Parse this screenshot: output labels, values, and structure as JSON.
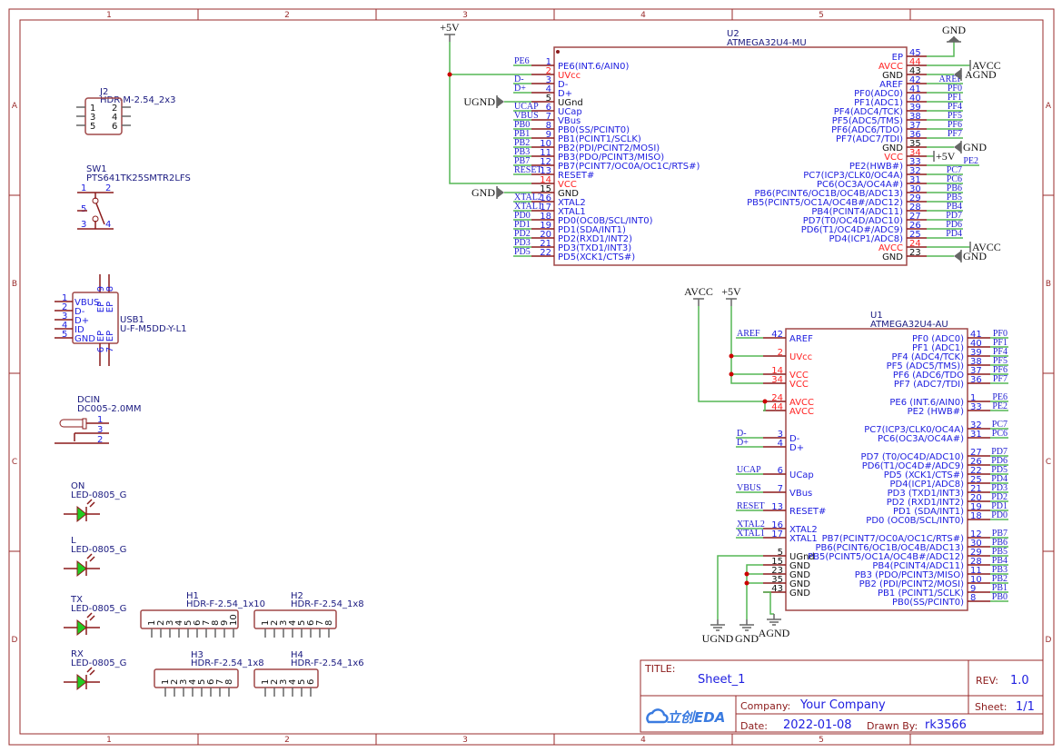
{
  "frame": {
    "columns": [
      "1",
      "2",
      "3",
      "4",
      "5"
    ],
    "rows": [
      "A",
      "B",
      "C",
      "D"
    ]
  },
  "u2": {
    "ref": "U2",
    "value": "ATMEGA32U4-MU",
    "left": [
      [
        "1",
        "PE6(INT.6/AIN0)",
        "PE6",
        "io"
      ],
      [
        "2",
        "UVcc",
        "",
        "pwr"
      ],
      [
        "3",
        "D-",
        "D-",
        "io"
      ],
      [
        "4",
        "D+",
        "D+",
        "io"
      ],
      [
        "5",
        "UGnd",
        "",
        "gnd"
      ],
      [
        "6",
        "UCap",
        "UCAP",
        "io"
      ],
      [
        "7",
        "VBus",
        "VBUS",
        "io"
      ],
      [
        "8",
        "PB0(SS/PCINT0)",
        "PB0",
        "io"
      ],
      [
        "9",
        "PB1(PCINT1/SCLK)",
        "PB1",
        "io"
      ],
      [
        "10",
        "PB2(PDI/PCINT2/MOSI)",
        "PB2",
        "io"
      ],
      [
        "11",
        "PB3(PDO/PCINT3/MISO)",
        "PB3",
        "io"
      ],
      [
        "12",
        "PB7(PCINT7/OC0A/OC1C/RTS#)",
        "PB7",
        "io"
      ],
      [
        "13",
        "RESET#",
        "RESET",
        "io"
      ],
      [
        "14",
        "VCC",
        "",
        "pwr"
      ],
      [
        "15",
        "GND",
        "",
        "gnd"
      ],
      [
        "16",
        "XTAL2",
        "XTAL2",
        "io"
      ],
      [
        "17",
        "XTAL1",
        "XTAL1",
        "io"
      ],
      [
        "18",
        "PD0(OC0B/SCL/INT0)",
        "PD0",
        "io"
      ],
      [
        "19",
        "PD1(SDA/INT1)",
        "PD1",
        "io"
      ],
      [
        "20",
        "PD2(RXD1/INT2)",
        "PD2",
        "io"
      ],
      [
        "21",
        "PD3(TXD1/INT3)",
        "PD3",
        "io"
      ],
      [
        "22",
        "PD5(XCK1/CTS#)",
        "PD5",
        "io"
      ]
    ],
    "right": [
      [
        "45",
        "EP",
        "",
        "io"
      ],
      [
        "44",
        "AVCC",
        "",
        "pwr"
      ],
      [
        "43",
        "GND",
        "",
        "gnd"
      ],
      [
        "42",
        "AREF",
        "AREF",
        "io"
      ],
      [
        "41",
        "PF0(ADC0)",
        "PF0",
        "io"
      ],
      [
        "40",
        "PF1(ADC1)",
        "PF1",
        "io"
      ],
      [
        "39",
        "PF4(ADC4/TCK)",
        "PF4",
        "io"
      ],
      [
        "38",
        "PF5(ADC5/TMS)",
        "PF5",
        "io"
      ],
      [
        "37",
        "PF6(ADC6/TDO)",
        "PF6",
        "io"
      ],
      [
        "36",
        "PF7(ADC7/TDI)",
        "PF7",
        "io"
      ],
      [
        "35",
        "GND",
        "",
        "gnd"
      ],
      [
        "34",
        "VCC",
        "",
        "pwr"
      ],
      [
        "33",
        "PE2(HWB#)",
        "PE2",
        "io"
      ],
      [
        "32",
        "PC7(ICP3/CLK0/OC4A)",
        "PC7",
        "io"
      ],
      [
        "31",
        "PC6(OC3A/OC4A#)",
        "PC6",
        "io"
      ],
      [
        "30",
        "PB6(PCINT6/OC1B/OC4B/ADC13)",
        "PB6",
        "io"
      ],
      [
        "29",
        "PB5(PCINT5/OC1A/OC4B#/ADC12)",
        "PB5",
        "io"
      ],
      [
        "28",
        "PB4(PCINT4/ADC11)",
        "PB4",
        "io"
      ],
      [
        "27",
        "PD7(T0/OC4D/ADC10)",
        "PD7",
        "io"
      ],
      [
        "26",
        "PD6(T1/OC4D#/ADC9)",
        "PD6",
        "io"
      ],
      [
        "25",
        "PD4(ICP1/ADC8)",
        "PD4",
        "io"
      ],
      [
        "24",
        "AVCC",
        "",
        "pwr"
      ],
      [
        "23",
        "GND",
        "",
        "gnd"
      ]
    ]
  },
  "u1": {
    "ref": "U1",
    "value": "ATMEGA32U4-AU",
    "left": [
      [
        "42",
        "AREF",
        "AREF",
        "io"
      ],
      [
        "2",
        "UVcc",
        "",
        "pwr"
      ],
      [
        "14",
        "VCC",
        "",
        "pwr"
      ],
      [
        "34",
        "VCC",
        "",
        "pwr"
      ],
      [
        "24",
        "AVCC",
        "",
        "pwr"
      ],
      [
        "44",
        "AVCC",
        "",
        "pwr"
      ],
      [
        "3",
        "D-",
        "D-",
        "io"
      ],
      [
        "4",
        "D+",
        "D+",
        "io"
      ],
      [
        "6",
        "UCap",
        "UCAP",
        "io"
      ],
      [
        "7",
        "VBus",
        "VBUS",
        "io"
      ],
      [
        "13",
        "RESET#",
        "RESET",
        "io"
      ],
      [
        "16",
        "XTAL2",
        "XTAL2",
        "io"
      ],
      [
        "17",
        "XTAL1",
        "XTAL1",
        "io"
      ],
      [
        "5",
        "UGnd",
        "",
        "gnd"
      ],
      [
        "15",
        "GND",
        "",
        "gnd"
      ],
      [
        "23",
        "GND",
        "",
        "gnd"
      ],
      [
        "35",
        "GND",
        "",
        "gnd"
      ],
      [
        "43",
        "GND",
        "",
        "gnd"
      ]
    ],
    "right": [
      [
        "41",
        "PF0 (ADC0)",
        "PF0",
        "io"
      ],
      [
        "40",
        "PF1 (ADC1)",
        "PF1",
        "io"
      ],
      [
        "39",
        "PF4 (ADC4/TCK)",
        "PF4",
        "io"
      ],
      [
        "38",
        "PF5 (ADC5/TMS))",
        "PF5",
        "io"
      ],
      [
        "37",
        "PF6 (ADC6/TDO",
        "PF6",
        "io"
      ],
      [
        "36",
        "PF7 (ADC7/TDI)",
        "PF7",
        "io"
      ],
      [
        "1",
        "PE6 (INT.6/AIN0)",
        "PE6",
        "io"
      ],
      [
        "33",
        "PE2 (HWB#)",
        "PE2",
        "io"
      ],
      [
        "32",
        "PC7(ICP3/CLK0/OC4A)",
        "PC7",
        "io"
      ],
      [
        "31",
        "PC6(OC3A/OC4A#)",
        "PC6",
        "io"
      ],
      [
        "27",
        "PD7 (T0/OC4D/ADC10)",
        "PD7",
        "io"
      ],
      [
        "26",
        "PD6(T1/OC4D#/ADC9)",
        "PD6",
        "io"
      ],
      [
        "22",
        "PD5 (XCK1/CTS#)",
        "PD5",
        "io"
      ],
      [
        "25",
        "PD4(ICP1/ADC8)",
        "PD4",
        "io"
      ],
      [
        "21",
        "PD3 (TXD1/INT3)",
        "PD3",
        "io"
      ],
      [
        "20",
        "PD2 (RXD1/INT2)",
        "PD2",
        "io"
      ],
      [
        "19",
        "PD1 (SDA/INT1)",
        "PD1",
        "io"
      ],
      [
        "18",
        "PD0 (OC0B/SCL/INT0)",
        "PD0",
        "io"
      ],
      [
        "12",
        "PB7(PCINT7/OC0A/OC1C/RTS#)",
        "PB7",
        "io"
      ],
      [
        "30",
        "PB6(PCINT6/OC1B/OC4B/ADC13)",
        "PB6",
        "io"
      ],
      [
        "29",
        "PB5(PCINT5/OC1A/OC4B#/ADC12)",
        "PB5",
        "io"
      ],
      [
        "28",
        "PB4(PCINT4/ADC11)",
        "PB4",
        "io"
      ],
      [
        "11",
        "PB3 (PDO/PCINT3/MISO)",
        "PB3",
        "io"
      ],
      [
        "10",
        "PB2 (PDI/PCINT2/MOSI)",
        "PB2",
        "io"
      ],
      [
        "9",
        "PB1 (PCINT1/SCLK)",
        "PB1",
        "io"
      ],
      [
        "8",
        "PB0(SS/PCINT0)",
        "PB0",
        "io"
      ]
    ]
  },
  "power": {
    "u2_5v": "+5V",
    "u2_ugnd": "UGND",
    "u2_gnd_left": "GND",
    "u2_gnd_ep": "GND",
    "u2_avcc_44": "AVCC",
    "u2_agnd": "AGND",
    "u2_gnd_35": "GND",
    "u2_5v_34": "+5V",
    "u2_avcc_24": "AVCC",
    "u2_gnd_23": "GND",
    "u1_avcc": "AVCC",
    "u1_5v": "+5V",
    "u1_ugnd": "UGND",
    "u1_gnd": "GND",
    "u1_agnd": "AGND"
  },
  "components": {
    "j2": {
      "ref": "J2",
      "value": "HDR-M-2.54_2x3",
      "pins": [
        "1",
        "2",
        "3",
        "4",
        "5",
        "6"
      ]
    },
    "sw1": {
      "ref": "SW1",
      "value": "PTS641TK25SMTR2LFS",
      "pins": [
        "1",
        "2",
        "3",
        "4",
        "5"
      ]
    },
    "usb1": {
      "ref": "USB1",
      "value": "U-F-M5DD-Y-L1",
      "pins": [
        "1",
        "2",
        "3",
        "4",
        "5"
      ],
      "names": [
        "VBUS",
        "D-",
        "D+",
        "ID",
        "GND"
      ],
      "ep": "EP",
      "ep_pins": [
        "9",
        "8",
        "6",
        "7"
      ]
    },
    "dcin": {
      "ref": "DCIN",
      "value": "DC005-2.0MM",
      "pins": [
        "1",
        "3",
        "2"
      ]
    },
    "leds": [
      {
        "ref": "ON",
        "value": "LED-0805_G"
      },
      {
        "ref": "L",
        "value": "LED-0805_G"
      },
      {
        "ref": "TX",
        "value": "LED-0805_G"
      },
      {
        "ref": "RX",
        "value": "LED-0805_G"
      }
    ],
    "headers": [
      {
        "ref": "H1",
        "value": "HDR-F-2.54_1x10",
        "count": 10
      },
      {
        "ref": "H2",
        "value": "HDR-F-2.54_1x8",
        "count": 8
      },
      {
        "ref": "H3",
        "value": "HDR-F-2.54_1x8",
        "count": 8
      },
      {
        "ref": "H4",
        "value": "HDR-F-2.54_1x6",
        "count": 6
      }
    ],
    "led_fill": "#22cc22"
  },
  "title_block": {
    "title_label": "TITLE:",
    "title": "Sheet_1",
    "rev_label": "REV:",
    "rev": "1.0",
    "company_label": "Company:",
    "company": "Your Company",
    "sheet_label": "Sheet:",
    "sheet": "1/1",
    "date_label": "Date:",
    "date": "2022-01-08",
    "drawn_label": "Drawn By:",
    "drawn": "rk3566",
    "logo": "立创EDA"
  }
}
